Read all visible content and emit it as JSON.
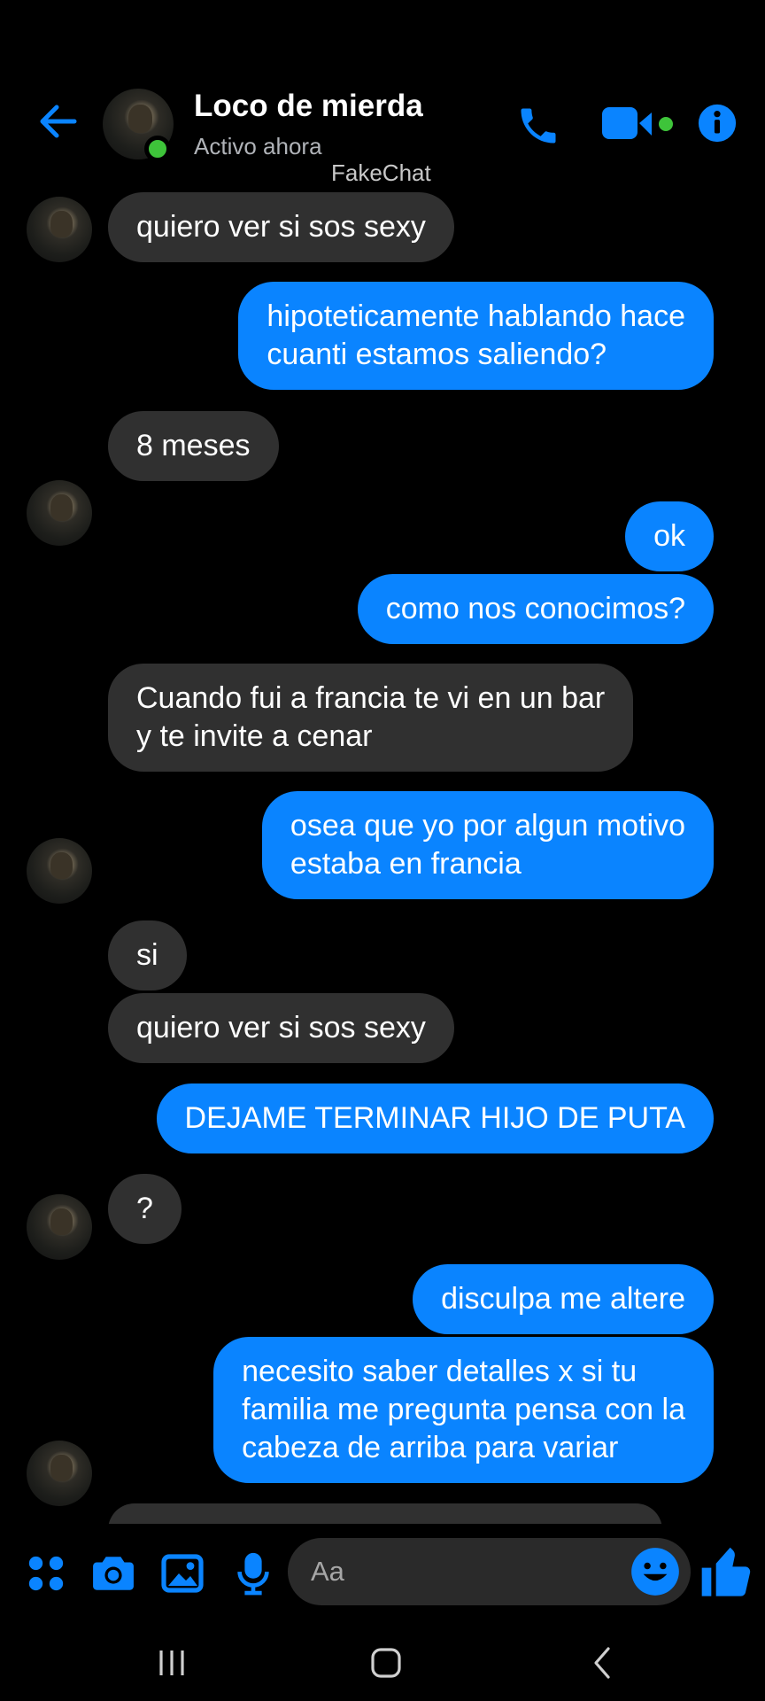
{
  "header": {
    "contact_name": "Loco de mierda",
    "status": "Activo ahora",
    "watermark": "FakeChat"
  },
  "messages": [
    {
      "from": "contact",
      "text": "quiero ver si sos sexy"
    },
    {
      "from": "me",
      "text": "hipoteticamente hablando hace\ncuanti estamos saliendo?"
    },
    {
      "from": "contact",
      "text": "8 meses"
    },
    {
      "from": "me",
      "text": "ok"
    },
    {
      "from": "me",
      "text": "como nos conocimos?"
    },
    {
      "from": "contact",
      "text": "Cuando fui a francia te vi en un bar\ny te invite a cenar"
    },
    {
      "from": "me",
      "text": "osea que yo por algun motivo\nestaba en francia"
    },
    {
      "from": "contact",
      "text": "si"
    },
    {
      "from": "contact",
      "text": "quiero ver si sos sexy"
    },
    {
      "from": "me",
      "text": "DEJAME TERMINAR HIJO DE PUTA"
    },
    {
      "from": "contact",
      "text": "?"
    },
    {
      "from": "me",
      "text": "disculpa me altere"
    },
    {
      "from": "me",
      "text": "necesito saber detalles x si tu\nfamilia me pregunta pensa con la\ncabeza de arriba para variar"
    }
  ],
  "composer": {
    "placeholder": "Aa"
  },
  "colors": {
    "accent": "#0a84ff",
    "incoming_bubble": "#303030",
    "online": "#3ec43a",
    "background": "#000000"
  },
  "icons": [
    "back-arrow-icon",
    "phone-icon",
    "video-camera-icon",
    "info-icon",
    "apps-icon",
    "camera-icon",
    "gallery-icon",
    "microphone-icon",
    "emoji-icon",
    "thumbs-up-icon",
    "recents-icon",
    "home-icon",
    "nav-back-icon"
  ]
}
